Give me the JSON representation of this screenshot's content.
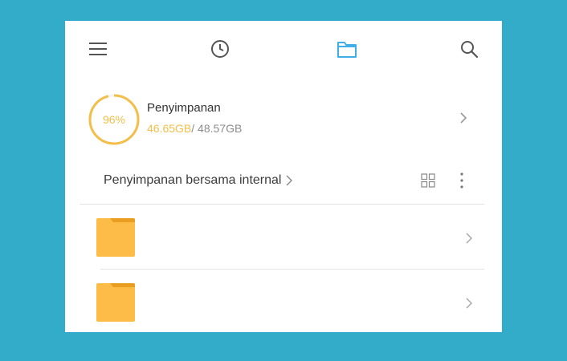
{
  "toolbar": {
    "icons": [
      "menu-icon",
      "recent-clock-icon",
      "folder-icon",
      "search-icon"
    ],
    "active": "folder-icon"
  },
  "storage": {
    "percent_label": "96%",
    "percent_value": 0.96,
    "title": "Penyimpanan",
    "used": "46.65GB",
    "total": "/ 48.57GB"
  },
  "path": {
    "label": "Penyimpanan bersama internal"
  },
  "folders": [
    {
      "icon": "folder-icon"
    },
    {
      "icon": "folder-icon"
    }
  ],
  "colors": {
    "background": "#33acc9",
    "accent_blue": "#3daee8",
    "storage_yellow": "#f3bf4a",
    "folder_yellow": "#fdbb47"
  }
}
